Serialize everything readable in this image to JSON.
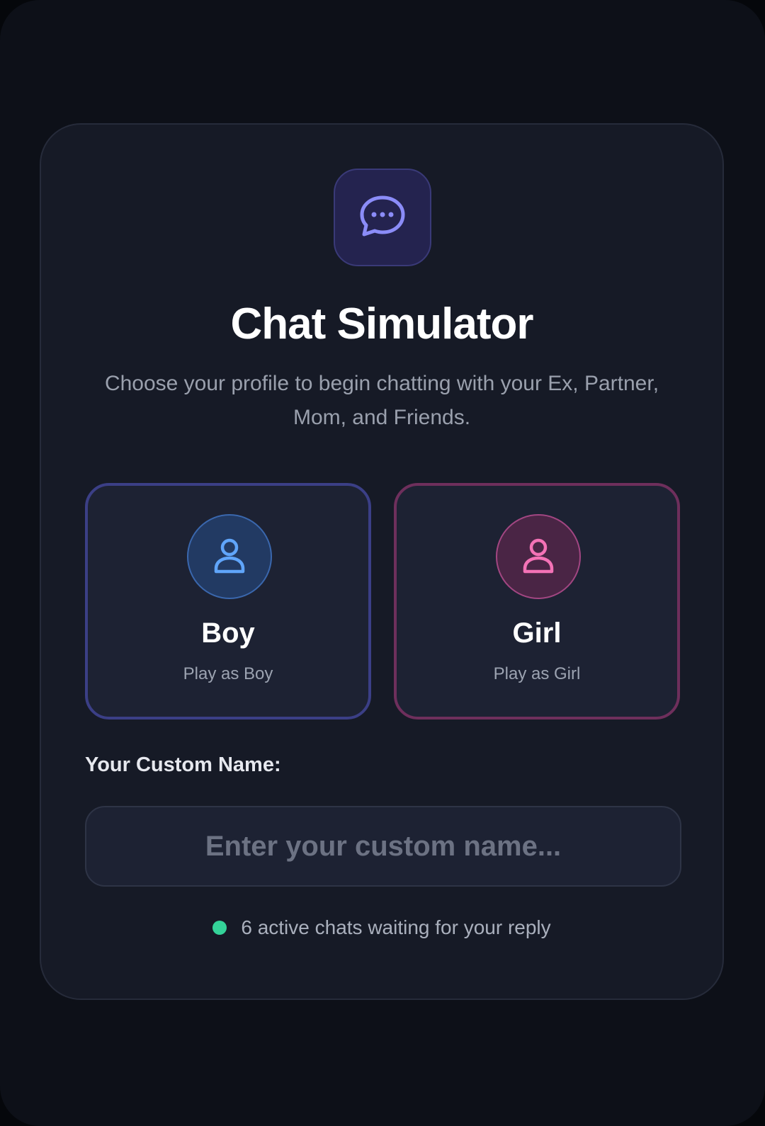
{
  "app": {
    "title": "Chat Simulator",
    "subtitle": "Choose your profile to begin chatting with your Ex, Partner, Mom, and Friends.",
    "icon": "chat-bubble-icon"
  },
  "profiles": [
    {
      "name": "Boy",
      "subtitle": "Play as Boy",
      "icon": "user-icon",
      "color": "#60a5fa"
    },
    {
      "name": "Girl",
      "subtitle": "Play as Girl",
      "icon": "user-icon",
      "color": "#f472b6"
    }
  ],
  "custom_name": {
    "label": "Your Custom Name:",
    "placeholder": "Enter your custom name...",
    "value": ""
  },
  "status": {
    "text": "6 active chats waiting for your reply",
    "dot_color": "#34d399"
  },
  "colors": {
    "accent": "#8b8cf8",
    "boy": "#60a5fa",
    "girl": "#f472b6",
    "online": "#34d399"
  }
}
